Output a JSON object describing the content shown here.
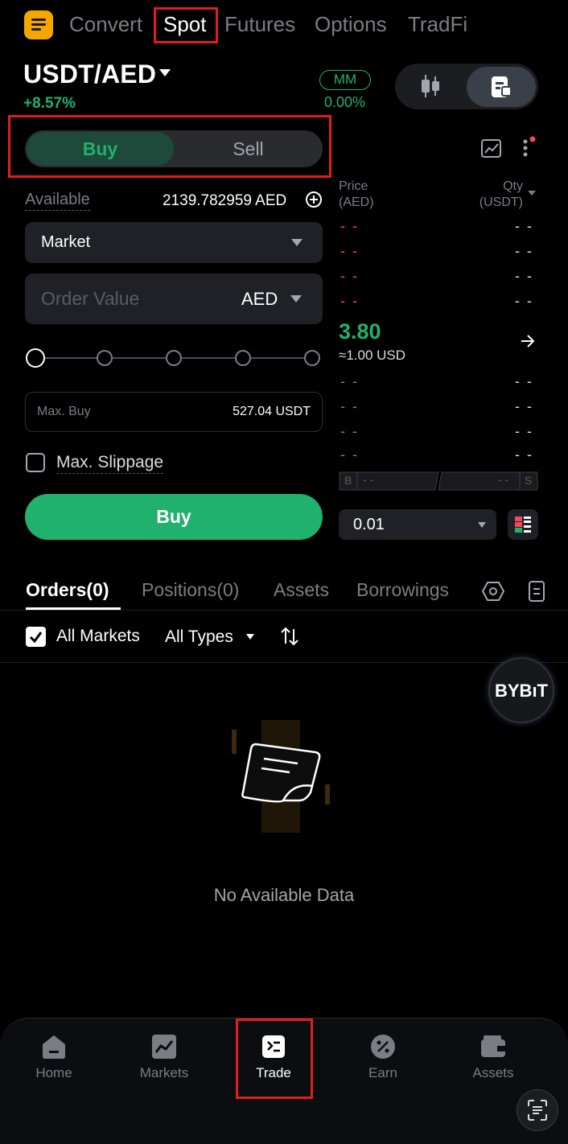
{
  "top_tabs": [
    "Convert",
    "Spot",
    "Futures",
    "Options",
    "TradFi"
  ],
  "pair": "USDT/AED",
  "change": "+8.57%",
  "mm_badge": "MM",
  "mm_value": "0.00%",
  "buy_tab": "Buy",
  "sell_tab": "Sell",
  "available_label": "Available",
  "available_value": "2139.782959 AED",
  "order_type": "Market",
  "order_value_placeholder": "Order Value",
  "order_currency": "AED",
  "max_buy_label": "Max. Buy",
  "max_buy_value": "527.04 USDT",
  "slider_level_percent": 0,
  "max_slippage_label": "Max. Slippage",
  "buy_button": "Buy",
  "orderbook": {
    "price_header": "Price",
    "price_unit": "(AED)",
    "qty_header": "Qty",
    "qty_unit": "(USDT)",
    "empty_cell": "- -",
    "last_price": "3.80",
    "last_price_usd": "≈1.00 USD",
    "b_label": "B",
    "s_label": "S",
    "precision": "0.01"
  },
  "bottom_tabs": [
    "Orders(0)",
    "Positions(0)",
    "Assets",
    "Borrowings"
  ],
  "filter_all_markets": "All Markets",
  "filter_all_types": "All Types",
  "empty_text": "No Available Data",
  "bybit_badge": "BYBıT",
  "nav": [
    "Home",
    "Markets",
    "Trade",
    "Earn",
    "Assets"
  ],
  "colors": {
    "green": "#20b26c",
    "red": "#f6465d",
    "brand": "#f7a600",
    "highlight": "#e11d1d"
  }
}
